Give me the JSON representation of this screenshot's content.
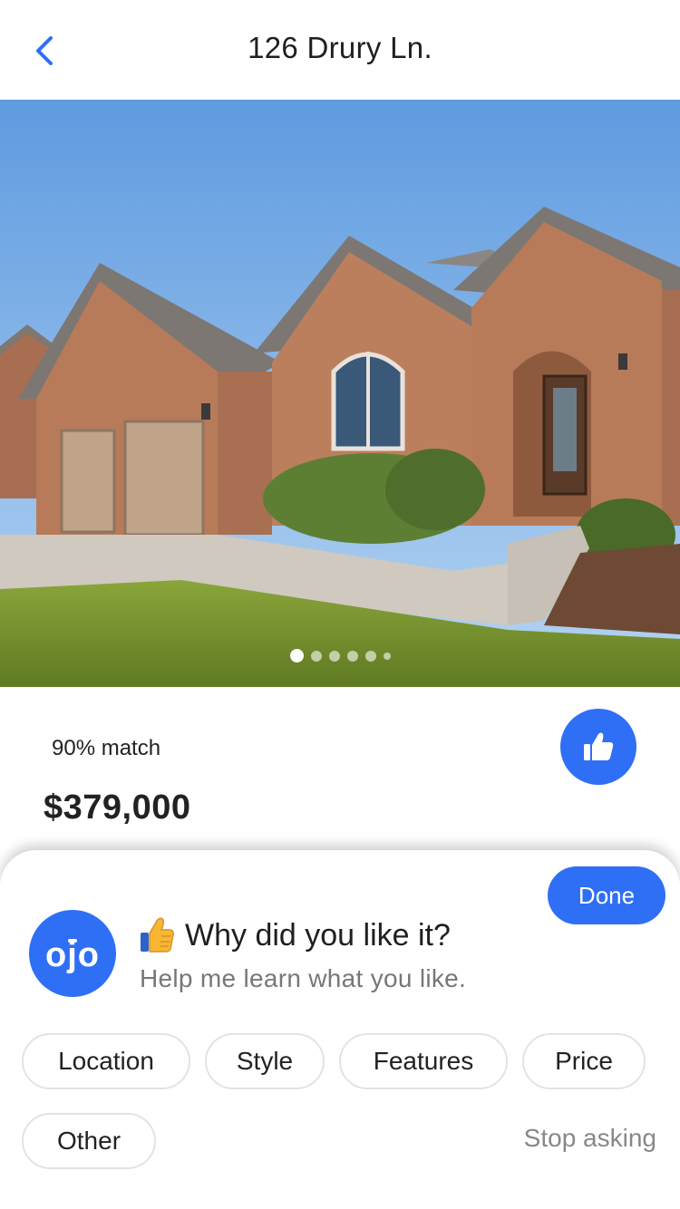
{
  "header": {
    "title": "126 Drury Ln.",
    "back_icon": "chevron-left-icon"
  },
  "photo": {
    "slide_count": 6,
    "active_slide": 1
  },
  "listing": {
    "match": "90% match",
    "price": "$379,000",
    "like_icon": "thumbs-up-icon"
  },
  "feedback": {
    "done_label": "Done",
    "logo_text": "ojo",
    "emoji": "thumbs-up-emoji",
    "question": "Why did you like it?",
    "helper": "Help me learn what you like.",
    "chips": [
      "Location",
      "Style",
      "Features",
      "Price",
      "Other"
    ],
    "stop_label": "Stop asking"
  },
  "colors": {
    "accent": "#2f6ff5",
    "text": "#222222",
    "muted": "#777777"
  }
}
